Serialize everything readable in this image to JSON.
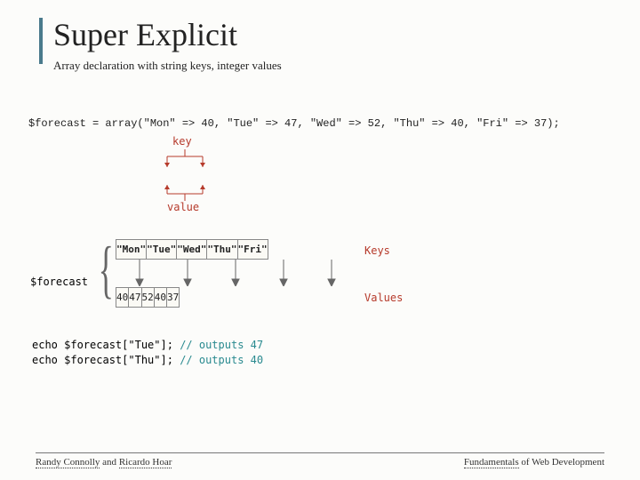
{
  "title": "Super Explicit",
  "subtitle": "Array declaration with string keys, integer values",
  "labels": {
    "key": "key",
    "value": "value",
    "keys_side": "Keys",
    "values_side": "Values",
    "forecast_var": "$forecast"
  },
  "code": {
    "declaration": "$forecast = array(\"Mon\" => 40, \"Tue\" => 47, \"Wed\" => 52, \"Thu\" => 40, \"Fri\" => 37);"
  },
  "array": {
    "keys": [
      "\"Mon\"",
      "\"Tue\"",
      "\"Wed\"",
      "\"Thu\"",
      "\"Fri\""
    ],
    "values": [
      "40",
      "47",
      "52",
      "40",
      "37"
    ]
  },
  "echo": [
    {
      "code": "echo $forecast[\"Tue\"];",
      "comment": "// outputs 47"
    },
    {
      "code": "echo $forecast[\"Thu\"];",
      "comment": "// outputs 40"
    }
  ],
  "footer": {
    "author1": "Randy Connolly",
    "join": " and ",
    "author2": "Ricardo Hoar",
    "right1": "Fundamentals",
    "right2": " of Web Development"
  }
}
